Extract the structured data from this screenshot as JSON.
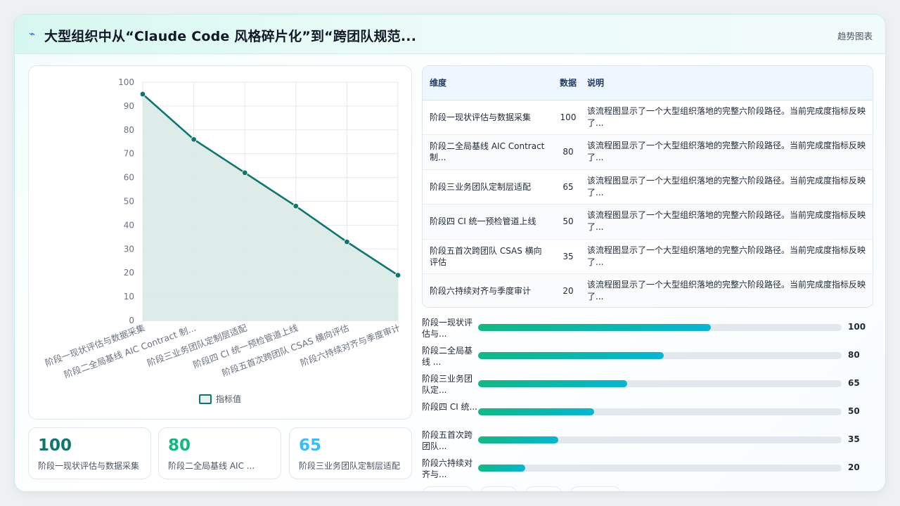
{
  "header": {
    "logo_icon": "lightning-icon",
    "title": "大型组织中从“Claude Code 风格碎片化”到“跨团队规范...",
    "tag": "趋势图表"
  },
  "chart_data": {
    "type": "area",
    "categories": [
      "阶段一现状评估与数据采集",
      "阶段二全局基线 AIC Contract 制...",
      "阶段三业务团队定制层适配",
      "阶段四 CI 统一预检管道上线",
      "阶段五首次跨团队 CSAS 横向评估",
      "阶段六持续对齐与季度审计"
    ],
    "series": [
      {
        "name": "指标值",
        "values": [
          95,
          76,
          62,
          48,
          33,
          19
        ]
      }
    ],
    "ylim": [
      0,
      100
    ],
    "yticks": [
      0,
      10,
      20,
      30,
      40,
      50,
      60,
      70,
      80,
      90,
      100
    ],
    "grid": true,
    "legend": "bottom",
    "colors": {
      "line": "#0f766e",
      "fill": "#dbeae8"
    }
  },
  "kpis": [
    {
      "value": "100",
      "label": "阶段一现状评估与数据采集",
      "color": "#0f766e"
    },
    {
      "value": "80",
      "label": "阶段二全局基线 AIC ...",
      "color": "#10b981"
    },
    {
      "value": "65",
      "label": "阶段三业务团队定制层适配",
      "color": "#38bdf8"
    }
  ],
  "table": {
    "headers": [
      "维度",
      "数据",
      "说明"
    ],
    "rows": [
      {
        "name": "阶段一现状评估与数据采集",
        "value": "100",
        "desc": "该流程图显示了一个大型组织落地的完整六阶段路径。当前完成度指标反映了..."
      },
      {
        "name": "阶段二全局基线 AIC Contract 制...",
        "value": "80",
        "desc": "该流程图显示了一个大型组织落地的完整六阶段路径。当前完成度指标反映了..."
      },
      {
        "name": "阶段三业务团队定制层适配",
        "value": "65",
        "desc": "该流程图显示了一个大型组织落地的完整六阶段路径。当前完成度指标反映了..."
      },
      {
        "name": "阶段四 CI 统一预检管道上线",
        "value": "50",
        "desc": "该流程图显示了一个大型组织落地的完整六阶段路径。当前完成度指标反映了..."
      },
      {
        "name": "阶段五首次跨团队 CSAS 横向评估",
        "value": "35",
        "desc": "该流程图显示了一个大型组织落地的完整六阶段路径。当前完成度指标反映了..."
      },
      {
        "name": "阶段六持续对齐与季度审计",
        "value": "20",
        "desc": "该流程图显示了一个大型组织落地的完整六阶段路径。当前完成度指标反映了..."
      }
    ]
  },
  "bars": {
    "max": 100,
    "items": [
      {
        "label": "阶段一现状评估与...",
        "value": 100,
        "fraction": 0.64
      },
      {
        "label": "阶段二全局基线 ...",
        "value": 80,
        "fraction": 0.51
      },
      {
        "label": "阶段三业务团队定...",
        "value": 65,
        "fraction": 0.41
      },
      {
        "label": "阶段四 CI 统...",
        "value": 50,
        "fraction": 0.32
      },
      {
        "label": "阶段五首次跨团队...",
        "value": 35,
        "fraction": 0.22
      },
      {
        "label": "阶段六持续对齐与...",
        "value": 20,
        "fraction": 0.13
      }
    ]
  }
}
